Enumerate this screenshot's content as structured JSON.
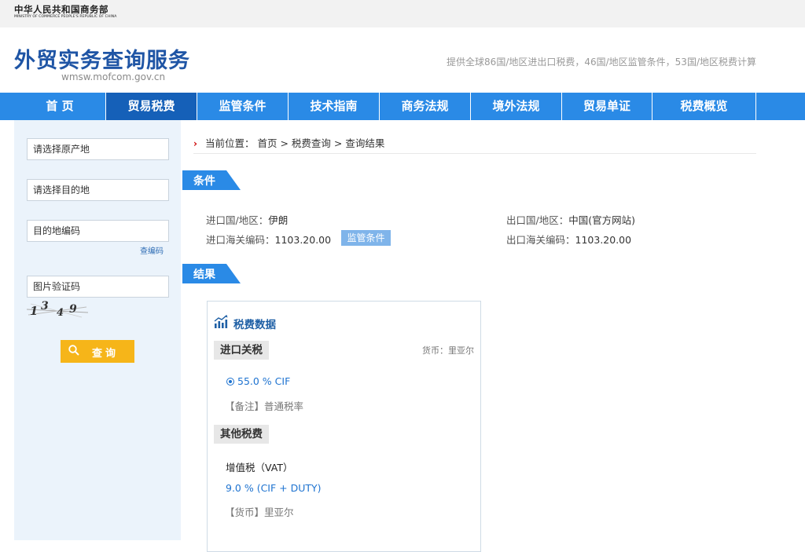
{
  "ministry": {
    "cn": "中华人民共和国商务部",
    "en": "MINISTRY OF COMMERCE PEOPLE'S REPUBLIC OF CHINA"
  },
  "site": {
    "title": "外贸实务查询服务",
    "domain": "wmsw.mofcom.gov.cn",
    "description": "提供全球86国/地区进出口税费，46国/地区监管条件，53国/地区税费计算"
  },
  "nav": [
    {
      "label": "首 页"
    },
    {
      "label": "贸易税费",
      "active": true
    },
    {
      "label": "监管条件"
    },
    {
      "label": "技术指南"
    },
    {
      "label": "商务法规"
    },
    {
      "label": "境外法规"
    },
    {
      "label": "贸易单证"
    },
    {
      "label": "税费概览"
    }
  ],
  "sidebar": {
    "origin_placeholder": "请选择原产地",
    "destination_placeholder": "请选择目的地",
    "dest_code_placeholder": "目的地编码",
    "lookup_code_link": "查编码",
    "captcha_placeholder": "图片验证码",
    "captcha_text": "1349",
    "query_button": "查询"
  },
  "breadcrumb": {
    "prefix": "当前位置：",
    "items": [
      "首页",
      "税费查询",
      "查询结果"
    ],
    "separator": " > "
  },
  "conditions": {
    "tab_label": "条件",
    "import_country_label": "进口国/地区：",
    "import_country": "伊朗",
    "import_code_label": "进口海关编码：",
    "import_code": "1103.20.00",
    "regulation_tag": "监管条件",
    "export_country_label": "出口国/地区：",
    "export_country": "中国",
    "export_official_site": "(官方网站)",
    "export_code_label": "出口海关编码：",
    "export_code": "1103.20.00"
  },
  "results": {
    "tab_label": "结果",
    "card_title": "税费数据",
    "import_duty_label": "进口关税",
    "currency_note": "货币：里亚尔",
    "duty_rate": "55.0 % CIF",
    "duty_remark": "【备注】普通税率",
    "other_taxes_label": "其他税费",
    "vat_label": "增值税（VAT）",
    "vat_rate": "9.0 % (CIF + DUTY)",
    "vat_currency": "【货币】里亚尔"
  },
  "colors": {
    "nav_bg": "#2a8ae6",
    "nav_active": "#1560b8",
    "title_blue": "#1f55a5",
    "query_button": "#f6b519",
    "sidebar_bg": "#ebf3fb"
  }
}
